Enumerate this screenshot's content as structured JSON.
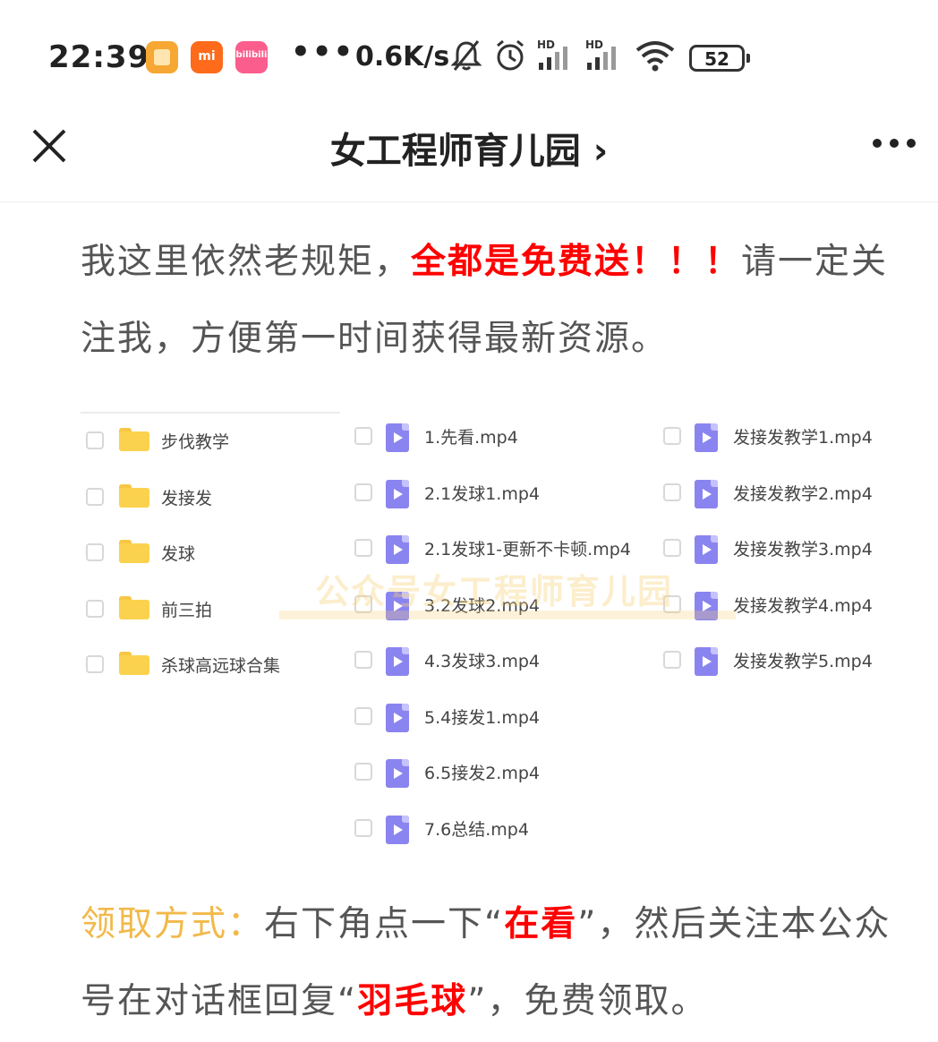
{
  "status_bar": {
    "time": "22:39",
    "app3_label": "bilibili",
    "app2_label": "mi",
    "overflow": "•••",
    "net_speed": "0.6K/s",
    "battery": "52",
    "icons": [
      "notification-app-icon",
      "mi-store-icon",
      "bilibili-icon",
      "mute-bell-icon",
      "alarm-icon",
      "hd-signal-icon",
      "hd-signal-icon",
      "wifi-icon",
      "battery-icon"
    ]
  },
  "nav": {
    "title": "女工程师育儿园",
    "title_chevron": "›"
  },
  "article": {
    "para1_prefix": "我这里依然老规矩，",
    "para1_highlight": "全都是免费送！！！",
    "para1_suffix": "请一定关注我，方便第一时间获得最新资源。",
    "para2_label": "领取方式：",
    "para2_a": "右下角点一下“",
    "para2_highlight1": "在看",
    "para2_b": "”，然后关注本公众号在对话框回复“",
    "para2_highlight2": "羽毛球",
    "para2_c": "”，免费领取。"
  },
  "listing": {
    "folders": [
      "步伐教学",
      "发接发",
      "发球",
      "前三拍",
      "杀球高远球合集"
    ],
    "videos_col2": [
      "1.先看.mp4",
      "2.1发球1.mp4",
      "2.1发球1-更新不卡顿.mp4",
      "3.2发球2.mp4",
      "4.3发球3.mp4",
      "5.4接发1.mp4",
      "6.5接发2.mp4",
      "7.6总结.mp4"
    ],
    "videos_col3": [
      "发接发教学1.mp4",
      "发接发教学2.mp4",
      "发接发教学3.mp4",
      "发接发教学4.mp4",
      "发接发教学5.mp4"
    ],
    "watermark": "公众号女工程师育儿园"
  },
  "colors": {
    "highlight_red": "#ff0000",
    "label_orange": "#f2b94a",
    "folder_yellow": "#fbd24e",
    "video_purple": "#8a84f0"
  }
}
